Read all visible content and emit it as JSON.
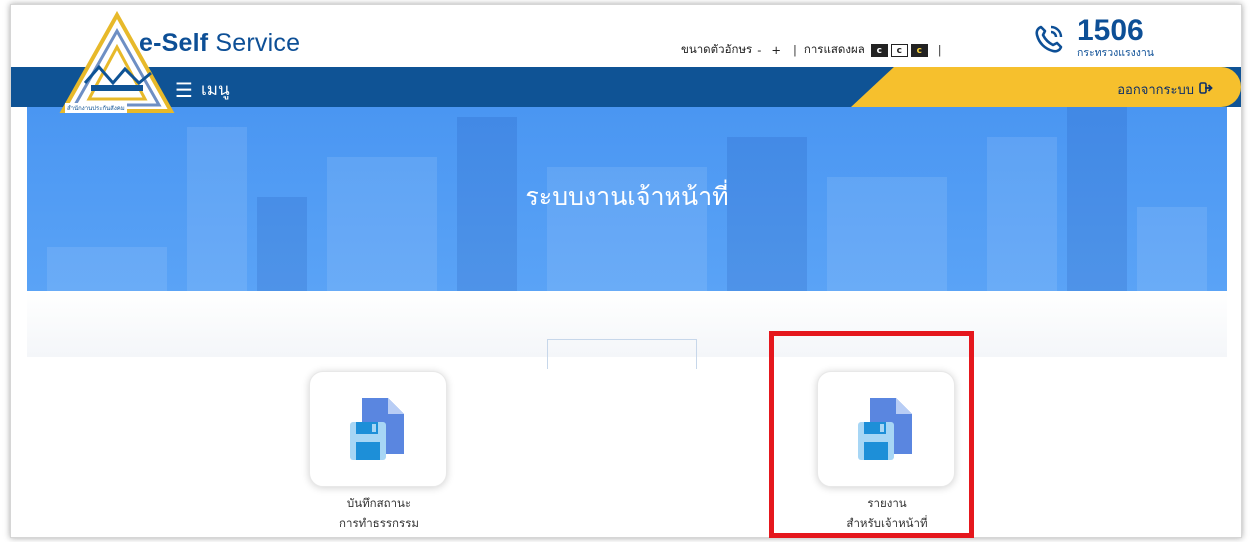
{
  "header": {
    "brand_bold": "e-Self",
    "brand_regular": " Service",
    "logo_caption": "สำนักงานประกันสังคม",
    "font_size_label": "ขนาดตัวอักษร",
    "font_decrease": "-",
    "font_increase": "+",
    "display_label": "การแสดงผล",
    "contrast_options": [
      "c",
      "c",
      "c"
    ],
    "hotline_number": "1506",
    "hotline_sub": "กระทรวงแรงงาน"
  },
  "navbar": {
    "menu_label": "เมนู",
    "logout_label": "ออกจากระบบ"
  },
  "banner": {
    "title": "ระบบงานเจ้าหน้าที่"
  },
  "cards": [
    {
      "line1": "บันทึกสถานะ",
      "line2": "การทำธรรกรรม"
    },
    {
      "line1": "รายงาน",
      "line2": "สำหรับเจ้าหน้าที่"
    }
  ],
  "colors": {
    "primary": "#0f5395",
    "accent": "#f6c02d",
    "banner": "#4a96f2",
    "highlight": "#e5171d"
  },
  "icons": {
    "menu": "hamburger-icon",
    "logout": "sign-out-icon",
    "hotline": "phone-icon",
    "card": "save-document-icon"
  }
}
